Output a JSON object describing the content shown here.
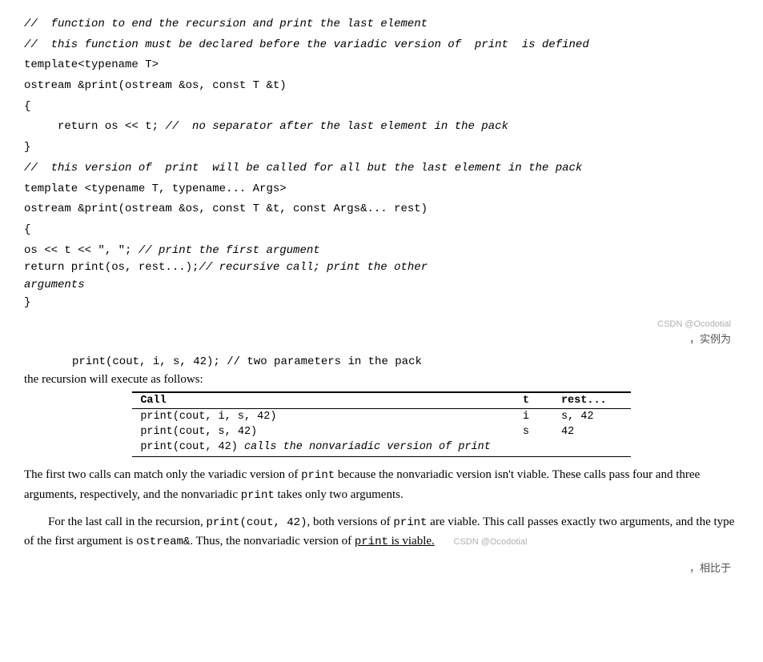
{
  "code": {
    "comment1": "//  function to end the recursion and print the last element",
    "comment2": "//  this function must be declared before the variadic version of  print  is defined",
    "line1": "template<typename T>",
    "line2": "ostream &print(ostream &os, const T &t)",
    "line3": "{",
    "line4": "     return os << t;",
    "comment3": "//  no separator after the last element in the pack",
    "line5": "}",
    "comment4": "//  this version of  print  will be called for all but the last element in the pack",
    "line6": "template <typename T, typename... Args>",
    "line7": "ostream &print(ostream &os, const T &t, const Args&... rest)",
    "line8": "{",
    "line9": "     os << t << \", \";",
    "comment5": "//  print the first argument",
    "line10": "       return print(os,  rest...);",
    "comment6_pre": "//  recursive call;",
    "comment6_post": "print the other",
    "line11": "arguments",
    "line12": "}"
  },
  "watermark1": "CSDN @Ocodotial",
  "chinese1": "，实例为",
  "print_example": "print(cout, i, s, 42);   //  two parameters in the pack",
  "recursion_label": "the recursion will execute as follows:",
  "table": {
    "col1": "Call",
    "col2": "t",
    "col3": "rest...",
    "rows": [
      {
        "call": "print(cout, i, s, 42)",
        "t": "i",
        "rest": "s, 42"
      },
      {
        "call": "print(cout, s, 42)",
        "t": "s",
        "rest": "42"
      },
      {
        "call": "print(cout, 42)",
        "italic": " calls the nonvariadic version of print",
        "t": "",
        "rest": ""
      }
    ]
  },
  "para1": {
    "text1": "The first two calls can match only the variadic version of ",
    "code1": "print",
    "text2": " because the nonvariadic version isn't viable. These calls pass four and three arguments, respectively, and the nonvariadic ",
    "code2": "print",
    "text3": " takes only two arguments."
  },
  "para2": {
    "text1": "For the last call in the recursion, ",
    "code1": "print(cout,  42)",
    "text2": ", both versions of ",
    "code2": "print",
    "text3": " are viable. This call passes exactly two arguments, and the type of the first argument is ",
    "code3": "ostream&",
    "text4": ". Thus, the nonvariadic version of ",
    "code4": "print",
    "text5": " is viable."
  },
  "watermark2": "CSDN @Ocodotial",
  "chinese2": "，相比于"
}
